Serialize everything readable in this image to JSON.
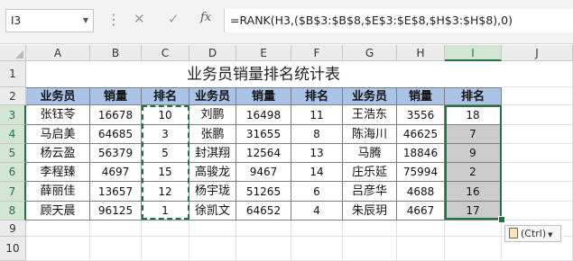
{
  "name_box": "I3",
  "formula_bar": {
    "formula": "=RANK(H3,($B$3:$B$8,$E$3:$E$8,$H$3:$H$8),0)",
    "cancel_icon": "✕",
    "enter_icon": "✓",
    "fx_label": "fx"
  },
  "columns": [
    "A",
    "B",
    "C",
    "D",
    "E",
    "F",
    "G",
    "H",
    "I",
    "J"
  ],
  "rows": [
    "1",
    "2",
    "3",
    "4",
    "5",
    "6",
    "7",
    "8",
    "9",
    "10"
  ],
  "sheet_title": "业务员销量排名统计表",
  "table": {
    "headers": [
      "业务员",
      "销量",
      "排名",
      "业务员",
      "销量",
      "排名",
      "业务员",
      "销量",
      "排名"
    ],
    "rows": [
      [
        "张钰苓",
        "16678",
        "10",
        "刘鹏",
        "16498",
        "11",
        "王浩东",
        "3556",
        "18"
      ],
      [
        "马启美",
        "64685",
        "3",
        "张鹏",
        "31655",
        "8",
        "陈海川",
        "46625",
        "7"
      ],
      [
        "杨云盈",
        "56379",
        "5",
        "封淇翔",
        "12564",
        "13",
        "马腾",
        "18846",
        "9"
      ],
      [
        "李程臻",
        "4697",
        "15",
        "高骏龙",
        "9467",
        "14",
        "庄乐延",
        "75994",
        "2"
      ],
      [
        "薛丽佳",
        "13657",
        "12",
        "杨宇珑",
        "51265",
        "6",
        "吕彦华",
        "4688",
        "16"
      ],
      [
        "顾天晨",
        "96125",
        "1",
        "徐凯文",
        "64652",
        "4",
        "朱辰玥",
        "4667",
        "17"
      ]
    ]
  },
  "paste_options_label": "(Ctrl)",
  "colors": {
    "header_fill": "#a9c4e7",
    "selection": "#217346",
    "selected_fill": "#cccccc"
  }
}
